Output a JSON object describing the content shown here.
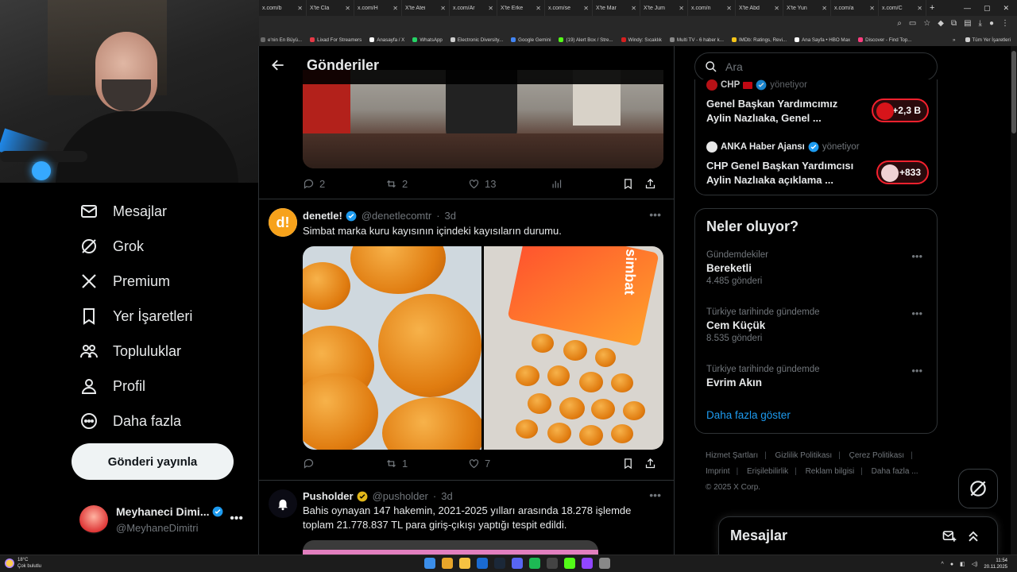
{
  "browser": {
    "tabs": [
      {
        "label": "x.com/b",
        "icon": "x-icon"
      },
      {
        "label": "X'te Cla",
        "icon": "x-icon"
      },
      {
        "label": "x.com/H",
        "icon": "x-icon"
      },
      {
        "label": "X'te Atei",
        "icon": "x-icon"
      },
      {
        "label": "x.com/Ar",
        "icon": "x-icon"
      },
      {
        "label": "X'te Erke",
        "icon": "x-icon"
      },
      {
        "label": "x.com/se",
        "icon": "x-icon"
      },
      {
        "label": "X'te Mar",
        "icon": "x-icon"
      },
      {
        "label": "X'te Jum",
        "icon": "x-icon"
      },
      {
        "label": "x.com/n",
        "icon": "x-icon"
      },
      {
        "label": "X'te Abd",
        "icon": "x-icon"
      },
      {
        "label": "X'te Yun",
        "icon": "x-icon"
      },
      {
        "label": "x.com/a",
        "icon": "x-icon"
      },
      {
        "label": "x.com/C",
        "icon": "x-icon"
      }
    ],
    "bookmarks": [
      {
        "label": "e'nin En Büyü...",
        "color": "#6a6a6a"
      },
      {
        "label": "Lixad For Streamers",
        "color": "#e63946"
      },
      {
        "label": "Anasayfa / X",
        "color": "#ffffff"
      },
      {
        "label": "WhatsApp",
        "color": "#25d366"
      },
      {
        "label": "Electronic Diversity...",
        "color": "#cccccc"
      },
      {
        "label": "Google Gemini",
        "color": "#4285f4"
      },
      {
        "label": "(19) Alert Box / Stre...",
        "color": "#53fc18"
      },
      {
        "label": "Windy: Sıcaklık",
        "color": "#d61f1f"
      },
      {
        "label": "Multi TV - 6 haber k...",
        "color": "#888888"
      },
      {
        "label": "IMDb: Ratings, Revi...",
        "color": "#f5c518"
      },
      {
        "label": "Ana Sayfa • HBO Max",
        "color": "#ffffff"
      },
      {
        "label": "Discover - Find Top...",
        "color": "#ff3d7f"
      }
    ],
    "bookmarks_right": "Tüm Yer İşaretleri"
  },
  "nav": {
    "items": [
      {
        "label": "Mesajlar",
        "icon": "envelope-icon"
      },
      {
        "label": "Grok",
        "icon": "grok-icon"
      },
      {
        "label": "Premium",
        "icon": "x-logo-icon"
      },
      {
        "label": "Yer İşaretleri",
        "icon": "bookmark-icon"
      },
      {
        "label": "Topluluklar",
        "icon": "communities-icon"
      },
      {
        "label": "Profil",
        "icon": "person-icon"
      },
      {
        "label": "Daha fazla",
        "icon": "more-circle-icon"
      }
    ],
    "post_button": "Gönderi yayınla",
    "account": {
      "name": "Meyhaneci Dimi...",
      "handle": "@MeyhaneDimitri"
    }
  },
  "main": {
    "title": "Gönderiler",
    "post1": {
      "reply": "2",
      "repost": "2",
      "like": "13"
    },
    "post2": {
      "name": "denetle!",
      "handle": "@denetlecomtr",
      "sep": "·",
      "time": "3d",
      "text": "Simbat marka kuru kayısının içindeki kayısıların durumu.",
      "reply": "",
      "repost": "1",
      "like": "7",
      "package_text": "simbat"
    },
    "post3": {
      "name": "Pusholder",
      "handle": "@pusholder",
      "sep": "·",
      "time": "3d",
      "text": "Bahis oynayan 147 hakemin, 2021-2025 yılları arasında 18.278 işlemde toplam 21.778.837 TL para giriş-çıkışı yaptığı tespit edildi."
    }
  },
  "search": {
    "placeholder": "Ara"
  },
  "news": [
    {
      "source": "CHP",
      "action": "yönetiyor",
      "title": "Genel Başkan Yardımcımız Aylin Nazlıaka, Genel ...",
      "count": "+2,3 B"
    },
    {
      "source": "ANKA Haber Ajansı",
      "action": "yönetiyor",
      "title": "CHP Genel Başkan Yardımcısı Aylin Nazlıaka açıklama ...",
      "count": "+833"
    }
  ],
  "trends": {
    "title": "Neler oluyor?",
    "items": [
      {
        "context": "Gündemdekiler",
        "name": "Bereketli",
        "count": "4.485 gönderi"
      },
      {
        "context": "Türkiye tarihinde gündemde",
        "name": "Cem Küçük",
        "count": "8.535 gönderi"
      },
      {
        "context": "Türkiye tarihinde gündemde",
        "name": "Evrim Akın",
        "count": ""
      }
    ],
    "show_more": "Daha fazla göster"
  },
  "footer": {
    "links": [
      "Hizmet Şartları",
      "Gizlilik Politikası",
      "Çerez Politikası",
      "Imprint",
      "Erişilebilirlik",
      "Reklam bilgisi",
      "Daha fazla ..."
    ],
    "copyright": "© 2025 X Corp."
  },
  "messages_drawer": {
    "title": "Mesajlar"
  },
  "taskbar": {
    "temp": "18°C",
    "weather": "Çok bulutlu",
    "time": "11:54",
    "date": "20.11.2025"
  },
  "colors": {
    "accent": "#1d9bf0",
    "bg": "#000000",
    "border": "#2f3336",
    "muted": "#71767b",
    "pill_border": "#f4212e"
  }
}
